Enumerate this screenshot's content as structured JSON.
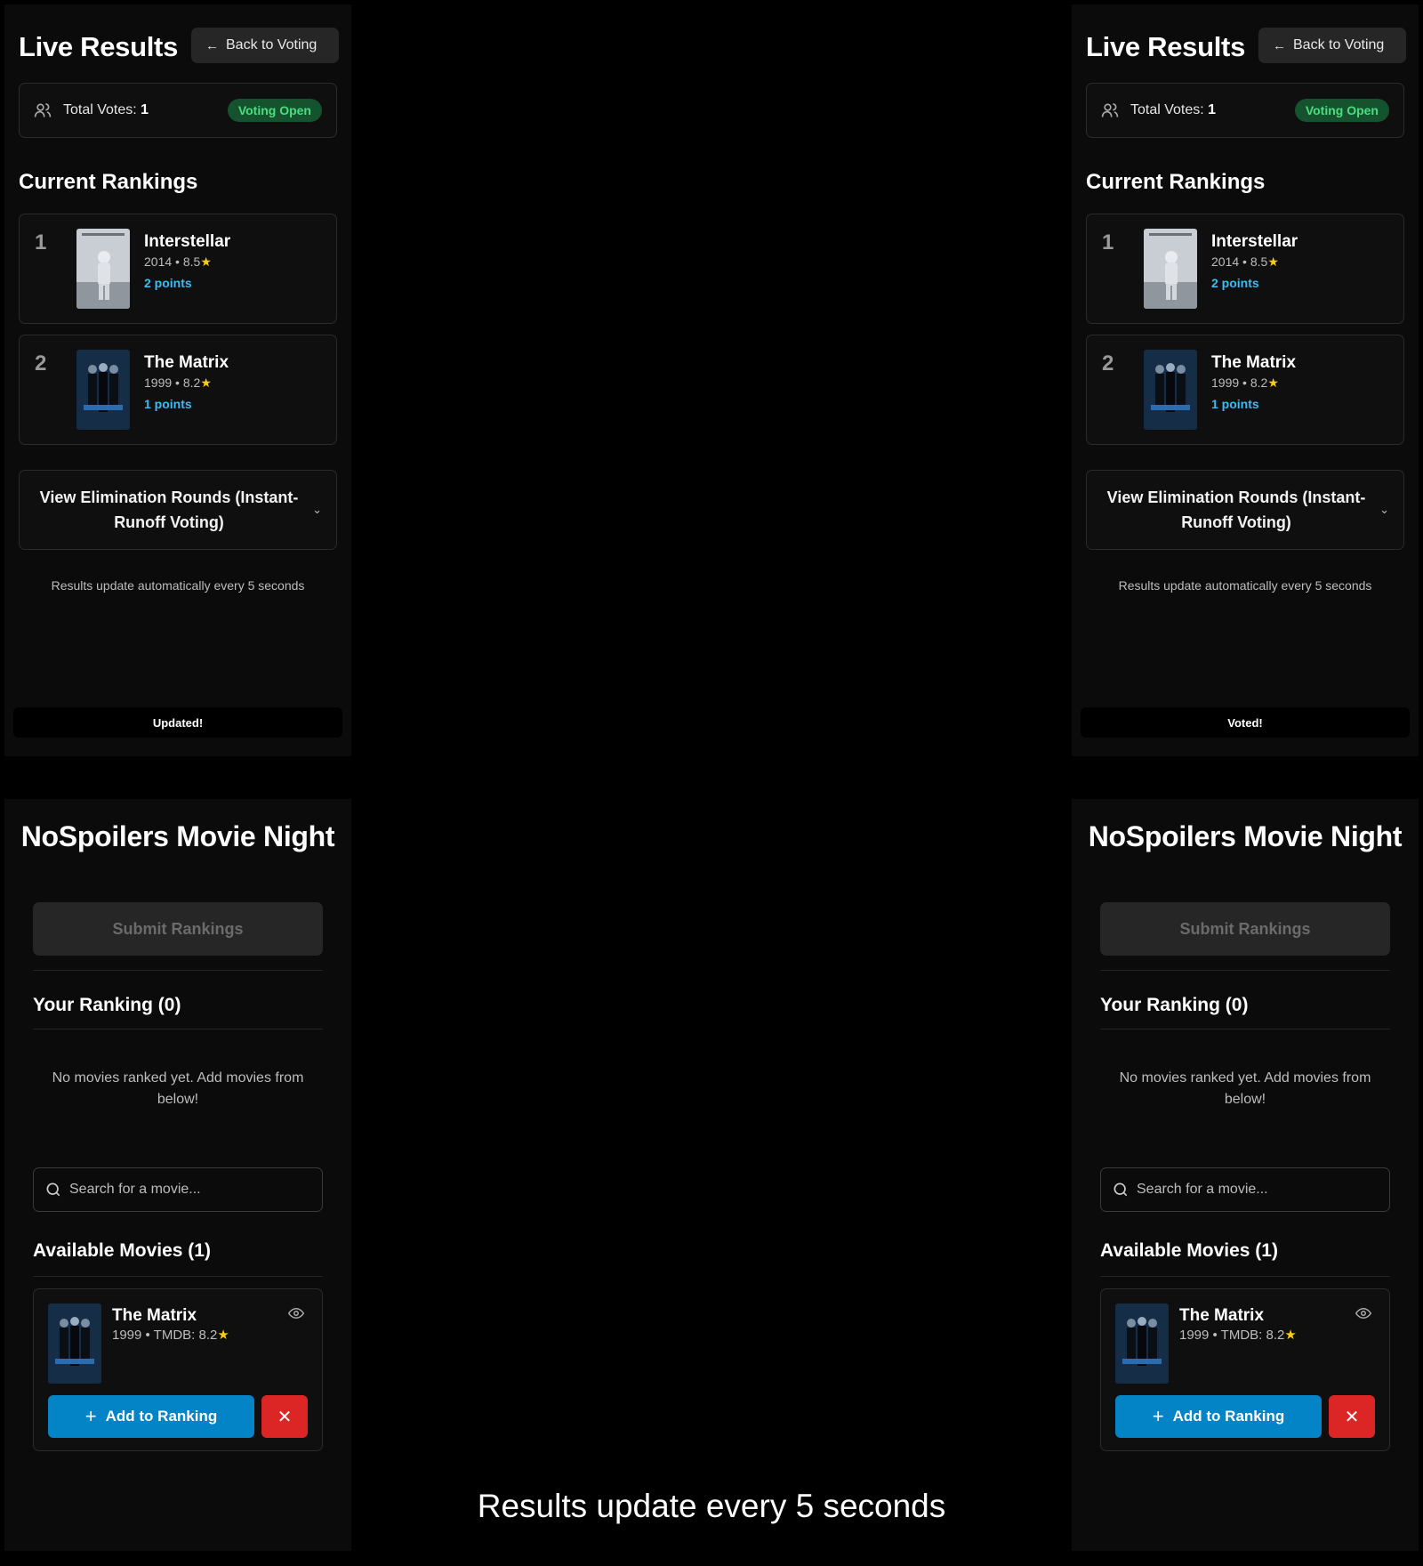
{
  "results": {
    "title": "Live Results",
    "back_label": "Back to Voting",
    "total_votes_label": "Total Votes:",
    "total_votes_value": "1",
    "status_badge": "Voting Open",
    "rankings_heading": "Current Rankings",
    "rankings": [
      {
        "rank": "1",
        "title": "Interstellar",
        "year": "2014",
        "rating": "8.5",
        "points": "2 points"
      },
      {
        "rank": "2",
        "title": "The Matrix",
        "year": "1999",
        "rating": "8.2",
        "points": "1 points"
      }
    ],
    "elimination_label": "View Elimination Rounds (Instant-Runoff Voting)",
    "auto_update_note": "Results update automatically every 5 seconds"
  },
  "toasts": {
    "left": "Updated!",
    "right": "Voted!"
  },
  "voting": {
    "app_title": "NoSpoilers Movie Night",
    "submit_label": "Submit Rankings",
    "your_ranking_heading": "Your Ranking (0)",
    "empty_message": "No movies ranked yet. Add movies from below!",
    "search_placeholder": "Search for a movie...",
    "available_heading": "Available Movies (1)",
    "available_movies": [
      {
        "title": "The Matrix",
        "meta": "1999 • TMDB: 8.2",
        "add_label": "Add to Ranking"
      }
    ]
  },
  "caption": "Results update every 5 seconds",
  "icons": {
    "back": "arrow-left-icon",
    "users": "users-icon",
    "chevron": "chevron-down-icon",
    "search": "search-icon",
    "eye": "eye-icon",
    "plus": "plus-icon",
    "close": "close-icon",
    "star": "star-icon"
  },
  "colors": {
    "accent": "#0284c7",
    "points": "#38bdf8",
    "badge_bg": "#14532d",
    "badge_text": "#4ade80",
    "danger": "#dc2626",
    "star": "#facc15"
  }
}
